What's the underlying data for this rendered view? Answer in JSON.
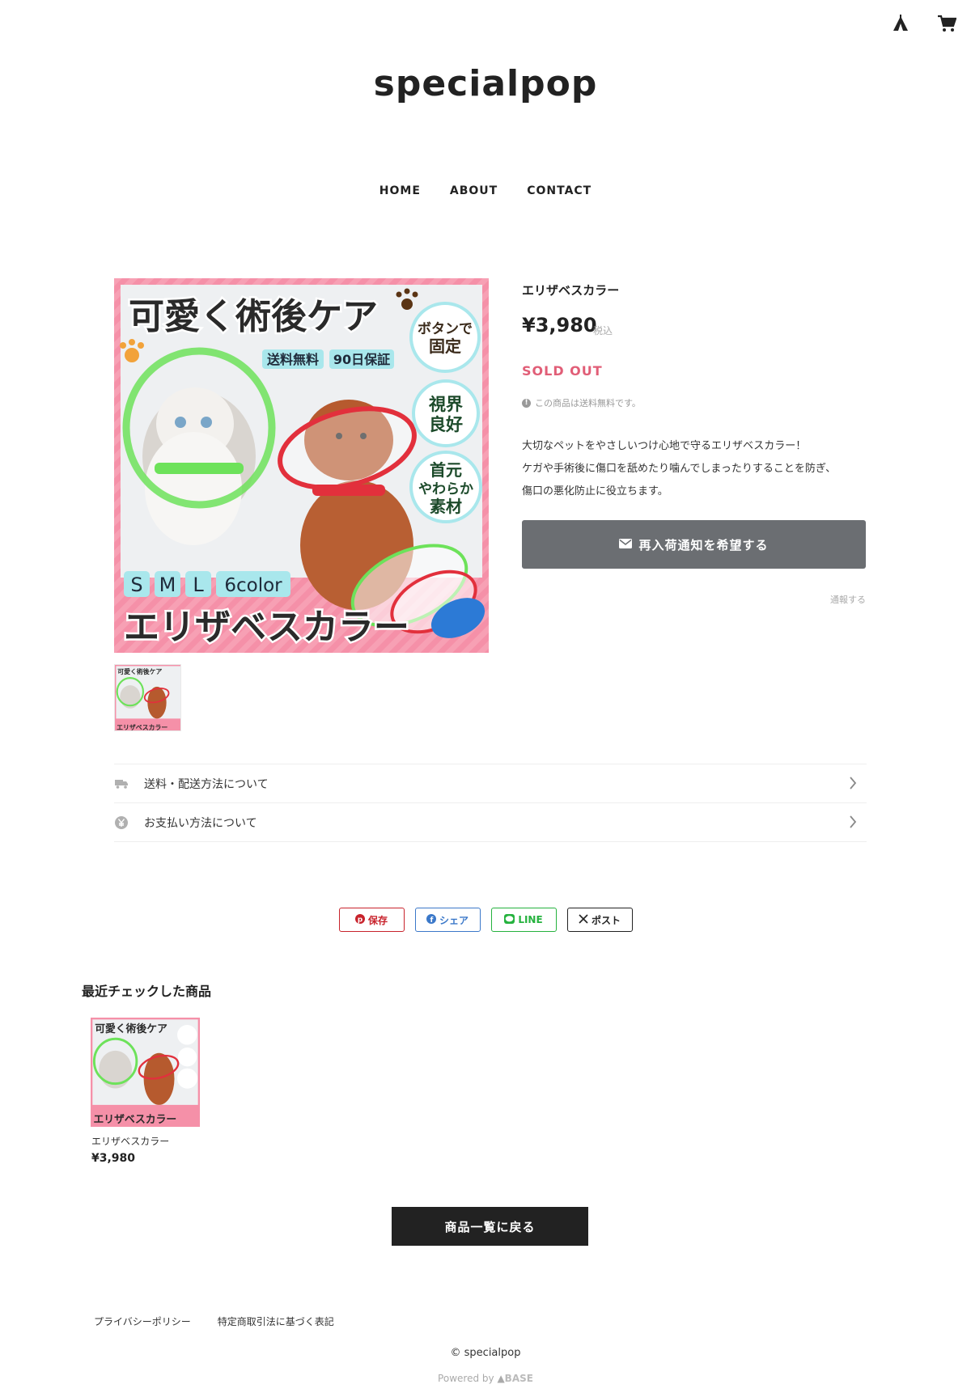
{
  "header": {
    "logo": "specialpop",
    "nav": [
      "HOME",
      "ABOUT",
      "CONTACT"
    ]
  },
  "product_image": {
    "headline": "可愛く術後ケア",
    "tags": [
      "送料無料",
      "90日保証"
    ],
    "badges": [
      "ボタンで固定",
      "視界良好",
      "首元やわらか素材"
    ],
    "sizes": [
      "S",
      "M",
      "L",
      "6color"
    ],
    "name_banner": "エリザベスカラー"
  },
  "product": {
    "title": "エリザベスカラー",
    "price": "¥3,980",
    "tax_label": "税込",
    "status": "SOLD OUT",
    "shipping_note": "この商品は送料無料です。",
    "description": [
      "大切なペットをやさしいつけ心地で守るエリザベスカラー！",
      "ケガや手術後に傷口を舐めたり噛んでしまったりすることを防ぎ、",
      "傷口の悪化防止に役立ちます。"
    ],
    "restock_button": "再入荷通知を希望する",
    "report_link": "通報する"
  },
  "accordion": [
    {
      "label": "送料・配送方法について",
      "icon": "truck-icon"
    },
    {
      "label": "お支払い方法について",
      "icon": "yen-icon"
    }
  ],
  "share": {
    "pinterest": "保存",
    "facebook": "シェア",
    "line": "LINE",
    "x": "ポスト"
  },
  "recent": {
    "heading": "最近チェックした商品",
    "items": [
      {
        "name": "エリザベスカラー",
        "price": "¥3,980"
      }
    ]
  },
  "back_button": "商品一覧に戻る",
  "footer": {
    "links": [
      "プライバシーポリシー",
      "特定商取引法に基づく表記"
    ],
    "copyright": "© specialpop",
    "powered": "Powered by",
    "powered_brand": "BASE"
  },
  "colors": {
    "sold_out": "#e15e77",
    "restock_button": "#6b6e72",
    "image_bg": "#f48aa3"
  }
}
